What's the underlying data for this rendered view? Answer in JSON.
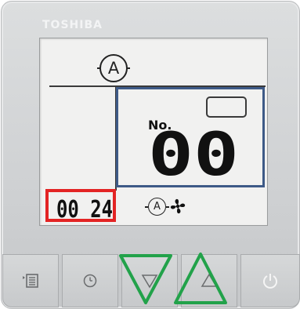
{
  "brand": "TOSHIBA",
  "display": {
    "top_mode_symbol": "A",
    "number_label": "No.",
    "number_value": "00",
    "time_value": "00 24",
    "bottom_mode_symbol": "A"
  },
  "buttons": {
    "menu": "menu-icon",
    "timer": "clock-icon",
    "down": "down-triangle-icon",
    "up": "up-triangle-icon",
    "power": "power-icon"
  },
  "colors": {
    "number_highlight": "#3e5a87",
    "time_highlight": "#e32424",
    "arrow_highlight": "#22a24a"
  }
}
